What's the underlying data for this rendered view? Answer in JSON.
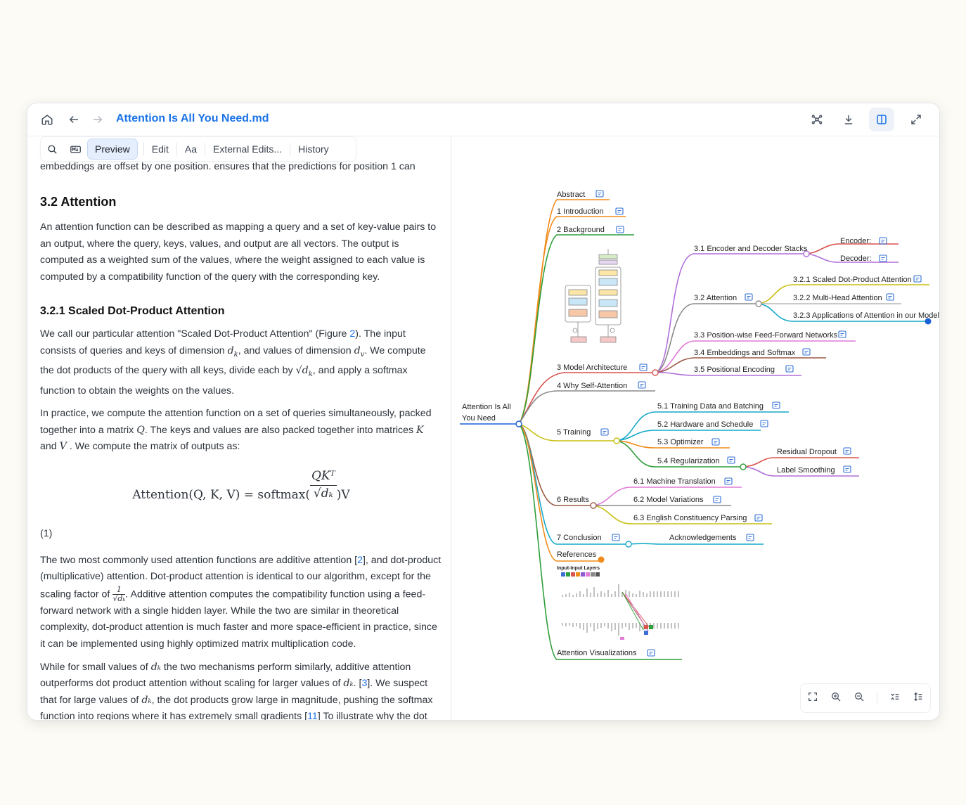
{
  "titlebar": {
    "title": "Attention Is All You Need.md",
    "icons": [
      "home-icon",
      "back-arrow-icon",
      "forward-arrow-icon",
      "mindmap-icon",
      "download-icon",
      "split-view-icon",
      "expand-icon"
    ]
  },
  "toolbar": {
    "preview_label": "Preview",
    "edit_label": "Edit",
    "font_label": "Aa",
    "external_label": "External Edits...",
    "history_label": "History"
  },
  "doc": {
    "top_line": "embeddings are offset by one position. ensures that the predictions for position 1 can",
    "h_attention": "3.2 Attention",
    "p1": "An attention function can be described as mapping a query and a set of key-value pairs to an output, where the query, keys, values, and output are all vectors. The output is computed as a weighted sum of the values, where the weight assigned to each value is computed by a compatibility function of the query with the corresponding key.",
    "h_scaled": "3.2.1 Scaled Dot-Product Attention",
    "p2a": "We call our particular attention \"Scaled Dot-Product Attention\" (Figure ",
    "p2_fig": "2",
    "p2b": "). The input consists of queries and keys of dimension ",
    "p2_dk": "d",
    "p2_dk_sub": "k",
    "p2c": ", and values of dimension ",
    "p2_dv": "d",
    "p2_dv_sub": "v",
    "p2d": ". We compute the dot products of the query with all keys, divide each by ",
    "p2_sqrt": "√d",
    "p2_sqrt_sub": "k",
    "p2e": ", and apply a softmax function to obtain the weights on the values.",
    "p3a": "In practice, we compute the attention function on a set of queries simultaneously, packed together into a matrix ",
    "p3_q": "Q",
    "p3b": ". The keys and values are also packed together into matrices ",
    "p3_k": "K",
    "p3c": " and ",
    "p3_v": "V",
    "p3d": " . We compute the matrix of outputs as:",
    "formula_left": "Attention(Q, K, V) = softmax(",
    "formula_num": "QKᵀ",
    "formula_den": "√dₖ",
    "formula_right": ")V",
    "eq_number": "(1)",
    "p4a": "The two most commonly used attention functions are additive attention [",
    "p4_ref": "2",
    "p4b": "], and dot-product (multiplicative) attention. Dot-product attention is identical to our algorithm, except for the scaling factor of ",
    "p4_frac_num": "1",
    "p4_frac_den": "√dₖ",
    "p4c": ". Additive attention computes the compatibility function using a feed-forward network with a single hidden layer. While the two are similar in theoretical complexity, dot-product attention is much faster and more space-efficient in practice, since it can be implemented using highly optimized matrix multiplication code.",
    "p5a": "While for small values of ",
    "p5_dk": "dₖ",
    "p5b": " the two mechanisms perform similarly, additive attention outperforms dot product attention without scaling for larger values of ",
    "p5_dk2": "dₖ",
    "p5c": ". [",
    "p5_ref": "3",
    "p5d": "]. We suspect that for large values of ",
    "p5_dk3": "dₖ",
    "p5e": ", the dot products grow large in magnitude, pushing the softmax function into regions where it has extremely small gradients [",
    "p5_ref2": "11",
    "p5f": "] To illustrate why the dot"
  },
  "mindmap": {
    "root": "Attention Is All You Need",
    "root_line1": "Attention Is All",
    "root_line2": "You Need",
    "abstract": "Abstract",
    "introduction": "1 Introduction",
    "background": "2 Background",
    "model_architecture": "3 Model Architecture",
    "encoder_decoder": "3.1 Encoder and Decoder Stacks",
    "encoder": "Encoder:",
    "decoder": "Decoder:",
    "attention": "3.2 Attention",
    "scaled": "3.2.1 Scaled Dot-Product Attention",
    "multihead": "3.2.2 Multi-Head Attention",
    "applications": "3.2.3 Applications of Attention in our Model",
    "ffn": "3.3 Position-wise Feed-Forward Networks",
    "embeddings": "3.4 Embeddings and Softmax",
    "positional": "3.5 Positional Encoding",
    "why_self": "4 Why Self-Attention",
    "training": "5 Training",
    "training_data": "5.1 Training Data and Batching",
    "hardware": "5.2 Hardware and Schedule",
    "optimizer": "5.3 Optimizer",
    "regularization": "5.4 Regularization",
    "residual_dropout": "Residual Dropout",
    "label_smoothing": "Label Smoothing",
    "results": "6 Results",
    "machine_translation": "6.1 Machine Translation",
    "model_variations": "6.2 Model Variations",
    "constituency": "6.3 English Constituency Parsing",
    "conclusion": "7 Conclusion",
    "acknowledgements": "Acknowledgements",
    "references": "References",
    "input_layers": "Input-Input Layers",
    "visualizations": "Attention Visualizations"
  },
  "colors": {
    "accent": "#1a73e8",
    "orange": "#f08c1c",
    "green": "#2e9e3a",
    "purple": "#b06fd8",
    "red": "#d9534f",
    "teal": "#17a9c9",
    "olive": "#c8bf12",
    "brown": "#9a5a44",
    "pink": "#e07bd6",
    "blue": "#1a5fd6"
  },
  "zoombar": {
    "icons": [
      "fit-screen-icon",
      "zoom-in-icon",
      "zoom-out-icon",
      "collapse-levels-icon",
      "expand-levels-icon"
    ]
  }
}
